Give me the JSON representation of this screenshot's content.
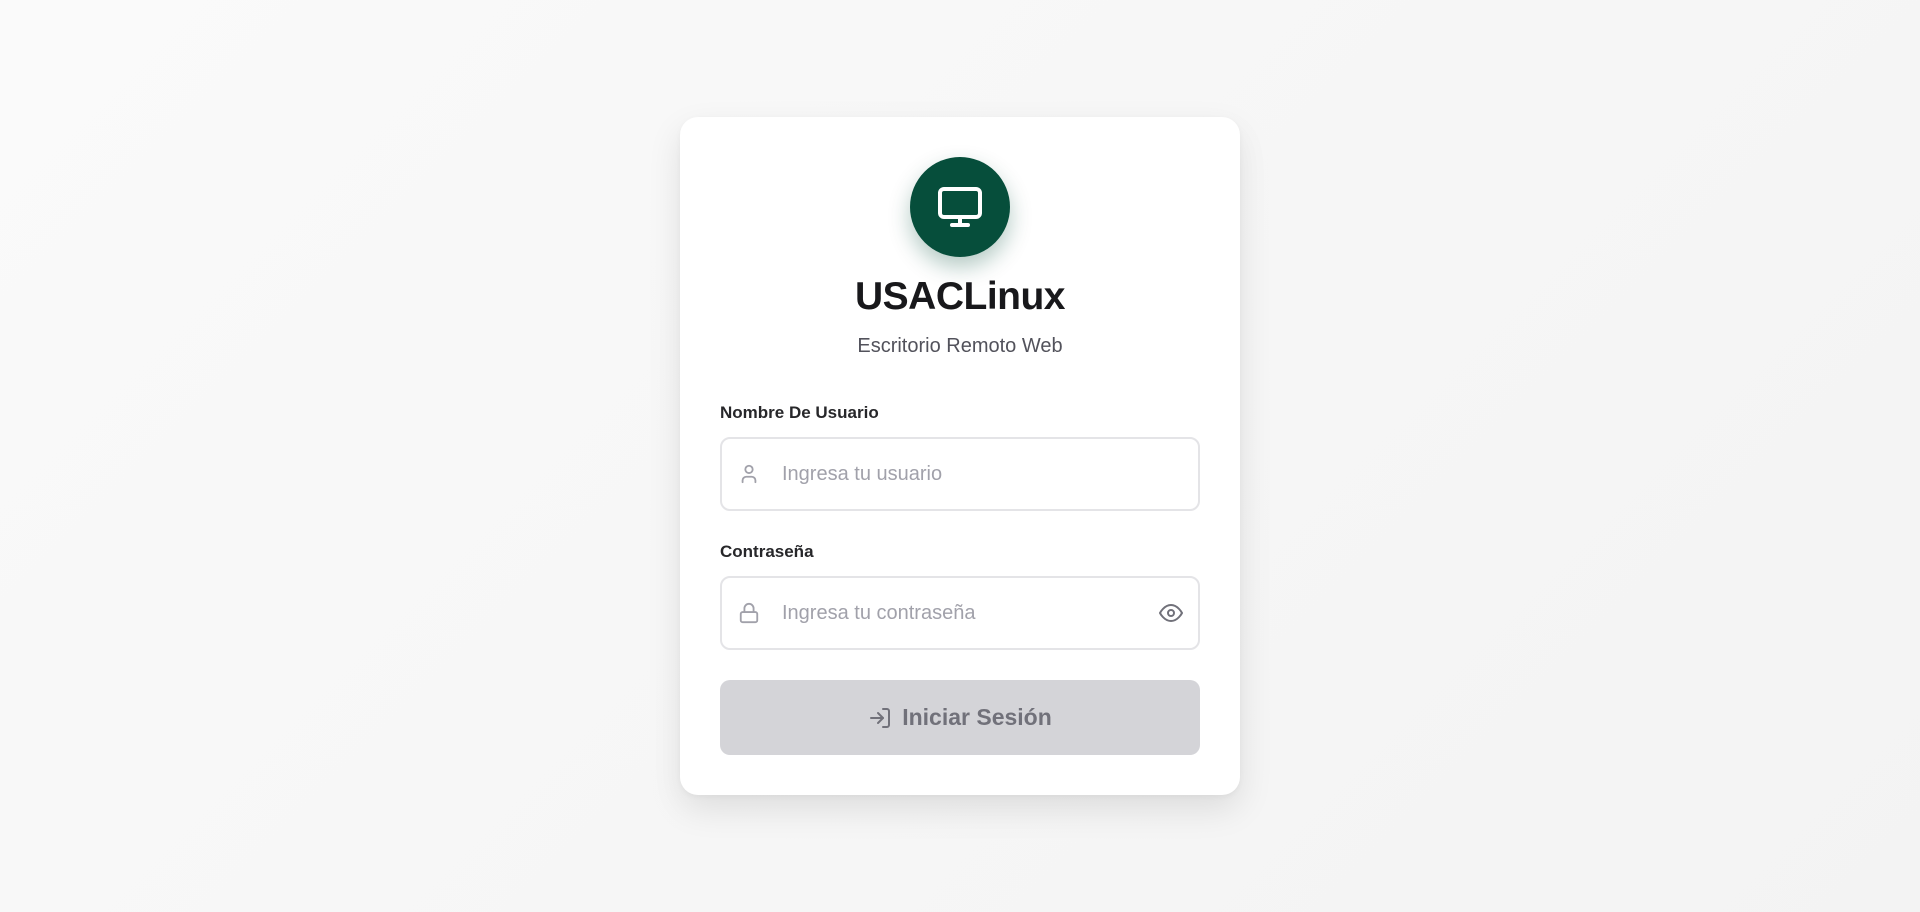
{
  "app": {
    "title": "USACLinux",
    "subtitle": "Escritorio Remoto Web",
    "logo_icon": "monitor-icon",
    "accent_color": "#064e3b"
  },
  "form": {
    "username": {
      "label": "Nombre De Usuario",
      "placeholder": "Ingresa tu usuario",
      "value": "",
      "icon": "user-icon"
    },
    "password": {
      "label": "Contraseña",
      "placeholder": "Ingresa tu contraseña",
      "value": "",
      "icon": "lock-icon",
      "toggle_icon": "eye-icon"
    },
    "submit": {
      "label": "Iniciar Sesión",
      "icon": "log-in-icon",
      "disabled": true
    }
  }
}
